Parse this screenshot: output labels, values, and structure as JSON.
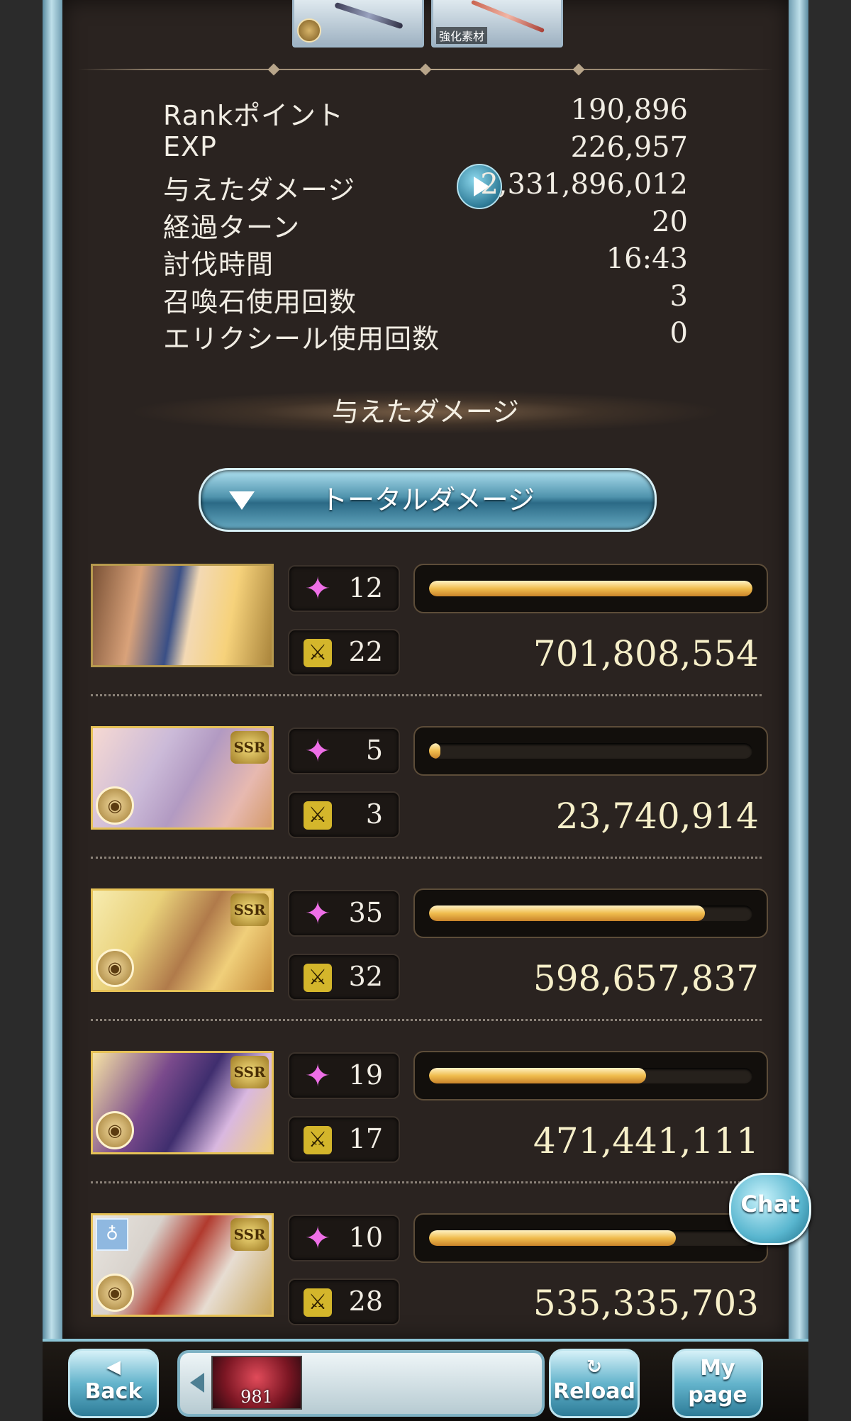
{
  "top_items": [
    {
      "tag": ""
    },
    {
      "tag": "強化素材"
    }
  ],
  "stats": [
    {
      "label": "Rankポイント",
      "value": "190,896"
    },
    {
      "label": "EXP",
      "value": "226,957"
    },
    {
      "label": "与えたダメージ",
      "value": "2,331,896,012"
    },
    {
      "label": "経過ターン",
      "value": "20"
    },
    {
      "label": "討伐時間",
      "value": "16:43"
    },
    {
      "label": "召喚石使用回数",
      "value": "3"
    },
    {
      "label": "エリクシール使用回数",
      "value": "0"
    }
  ],
  "section_title": "与えたダメージ",
  "sort_button_label": "トータルダメージ",
  "members": [
    {
      "skill_count": "12",
      "attack_count": "22",
      "damage": "701,808,554",
      "damage_fraction": 1.0,
      "ssr": false,
      "ssr_label": ""
    },
    {
      "skill_count": "5",
      "attack_count": "3",
      "damage": "23,740,914",
      "damage_fraction": 0.034,
      "ssr": true,
      "ssr_label": "SSR"
    },
    {
      "skill_count": "35",
      "attack_count": "32",
      "damage": "598,657,837",
      "damage_fraction": 0.853,
      "ssr": true,
      "ssr_label": "SSR"
    },
    {
      "skill_count": "19",
      "attack_count": "17",
      "damage": "471,441,111",
      "damage_fraction": 0.672,
      "ssr": true,
      "ssr_label": "SSR"
    },
    {
      "skill_count": "10",
      "attack_count": "28",
      "damage": "535,335,703",
      "damage_fraction": 0.763,
      "ssr": true,
      "ssr_label": "SSR"
    }
  ],
  "chat_label": "Chat",
  "bottom_bar": {
    "back_label": "Back",
    "item_count": "981",
    "reload_label": "Reload",
    "mypage_label": "My page"
  },
  "colors": {
    "panel_bg": "#2a2320",
    "bar_fill": "#f0bd4e",
    "frame_accent": "#8cc5d6"
  }
}
